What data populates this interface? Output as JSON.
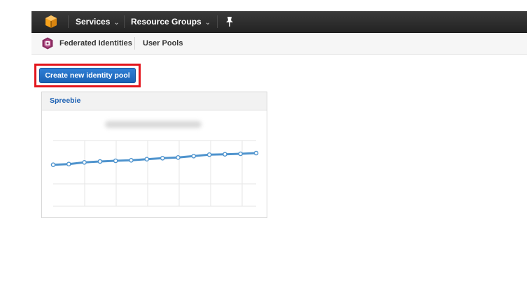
{
  "topbar": {
    "services_label": "Services",
    "resource_groups_label": "Resource Groups",
    "colors": {
      "background": "#2b2b2b",
      "logo": "#f7a21b"
    }
  },
  "subnav": {
    "federated_identities_label": "Federated Identities",
    "user_pools_label": "User Pools"
  },
  "main": {
    "create_button_label": "Create new identity pool",
    "highlight_color": "#e3151c",
    "button_color": "#2a7ad2"
  },
  "pool_card": {
    "name": "Spreebie",
    "line_color": "#4e93cd",
    "trend_values": [
      0.1,
      0.13,
      0.2,
      0.24,
      0.27,
      0.29,
      0.34,
      0.38,
      0.41,
      0.47,
      0.53,
      0.55,
      0.57,
      0.6
    ]
  }
}
